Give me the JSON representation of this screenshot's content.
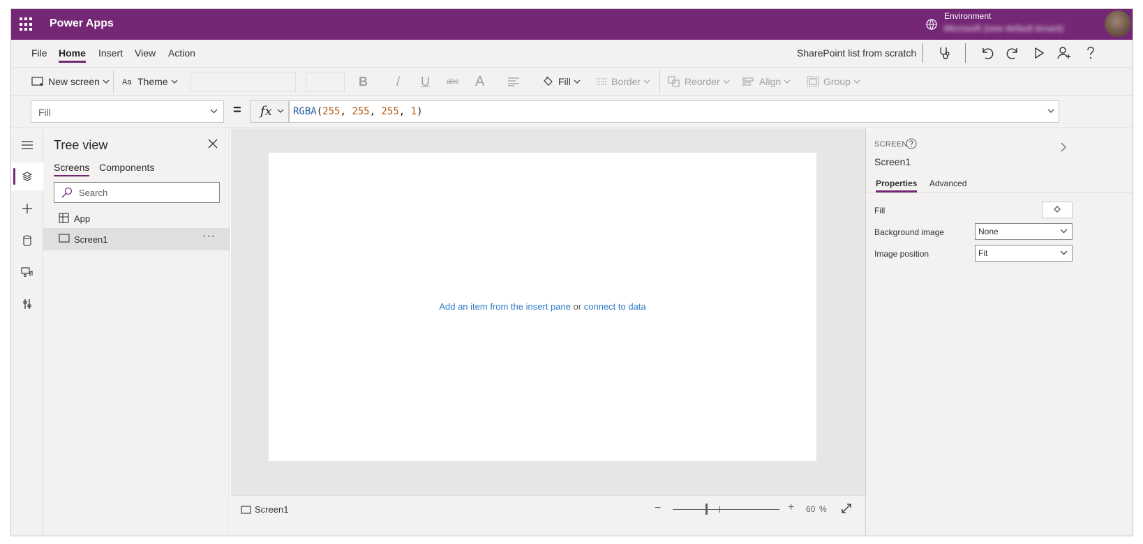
{
  "header": {
    "app_title": "Power Apps",
    "environment_label": "Environment",
    "environment_name": "Microsoft (new default tenant)",
    "brand_color": "#742774"
  },
  "menu": {
    "items": [
      "File",
      "Home",
      "Insert",
      "View",
      "Action"
    ],
    "active": "Home",
    "app_name": "SharePoint list from scratch",
    "icons": [
      "app-checker-icon",
      "undo-icon",
      "redo-icon",
      "play-icon",
      "share-icon",
      "help-icon"
    ]
  },
  "ribbon": {
    "new_screen": "New screen",
    "theme": "Theme",
    "bold": "B",
    "italic": "/",
    "underline": "U",
    "strikethrough": "abc",
    "font_color": "A",
    "fill": "Fill",
    "border": "Border",
    "reorder": "Reorder",
    "align": "Align",
    "group": "Group"
  },
  "formula_bar": {
    "property": "Fill",
    "equals": "=",
    "fx": "fx",
    "function": "RGBA",
    "open_paren": "(",
    "args": [
      "255",
      "255",
      "255",
      "1"
    ],
    "sep": ", ",
    "close_paren": ")"
  },
  "tree_view": {
    "title": "Tree view",
    "tabs": [
      "Screens",
      "Components"
    ],
    "search_placeholder": "Search",
    "items": [
      "App",
      "Screen1"
    ],
    "selected": "Screen1",
    "more": "···"
  },
  "canvas": {
    "hint_link1": "Add an item from the insert pane",
    "hint_or": "or",
    "hint_link2": "connect to data"
  },
  "status_bar": {
    "screen": "Screen1",
    "zoom_minus": "−",
    "zoom_plus": "+",
    "zoom_value": "60",
    "zoom_unit": "%",
    "zoom_fraction": 0.6
  },
  "right_pane": {
    "kind": "SCREEN",
    "name": "Screen1",
    "tabs": [
      "Properties",
      "Advanced"
    ],
    "fill_label": "Fill",
    "background_image_label": "Background image",
    "background_image_value": "None",
    "image_position_label": "Image position",
    "image_position_value": "Fit"
  }
}
